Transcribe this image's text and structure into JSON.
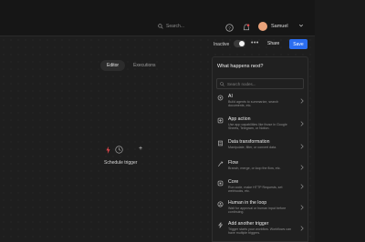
{
  "header": {
    "search_placeholder": "Search...",
    "user_name": "Samuel"
  },
  "toolbar": {
    "status_label": "Inactive",
    "more_label": "•••",
    "share_label": "Share",
    "save_label": "Save"
  },
  "tabs": [
    {
      "label": "Editor"
    },
    {
      "label": "Executions"
    }
  ],
  "canvas": {
    "trigger_label": "Schedule trigger",
    "plus_label": "+"
  },
  "panel": {
    "title": "What happens next?",
    "search_placeholder": "Search nodes...",
    "items": [
      {
        "title": "AI",
        "desc": "Build agents to summarize, search documents, etc.",
        "icon": "ai-icon"
      },
      {
        "title": "App action",
        "desc": "Use app capabilities like those in Google Sheets, Telegram, or Notion.",
        "icon": "app-action-icon"
      },
      {
        "title": "Data transformation",
        "desc": "Manipulate, filter, or convert data.",
        "icon": "data-transformation-icon"
      },
      {
        "title": "Flow",
        "desc": "Branch, merge, or loop the flow, etc.",
        "icon": "flow-icon"
      },
      {
        "title": "Core",
        "desc": "Run code, make HTTP Requests, set webhooks, etc.",
        "icon": "core-icon"
      },
      {
        "title": "Human in the loop",
        "desc": "Wait for approval or human input before continuing.",
        "icon": "human-icon"
      },
      {
        "title": "Add another trigger",
        "desc": "Trigger starts your workflow. Workflows can have multiple triggers.",
        "icon": "trigger-icon"
      }
    ]
  },
  "colors": {
    "accent": "#2a6df0",
    "trigger": "#e5484d"
  }
}
